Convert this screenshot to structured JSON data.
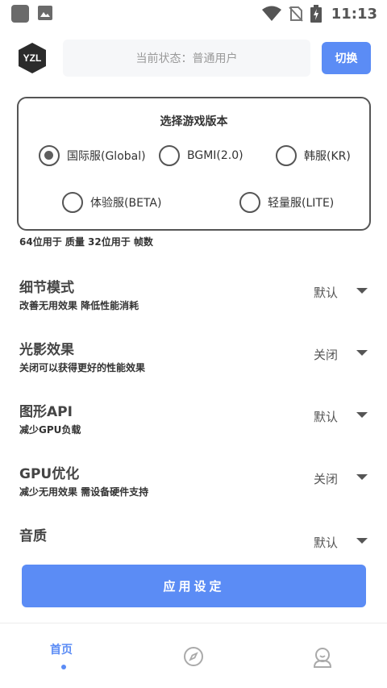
{
  "status_bar": {
    "time": "11:13"
  },
  "header": {
    "logo_text": "YZL",
    "status_text": "当前状态：普通用户",
    "switch_label": "切换"
  },
  "dialog": {
    "title": "选择游戏版本",
    "options": [
      {
        "label": "国际服(Global)",
        "checked": true
      },
      {
        "label": "BGMI(2.0)",
        "checked": false
      },
      {
        "label": "韩服(KR)",
        "checked": false
      },
      {
        "label": "体验服(BETA)",
        "checked": false
      },
      {
        "label": "轻量服(LITE)",
        "checked": false
      }
    ]
  },
  "settings": {
    "partial_top_text": "64位用于 质量 32位用于 帧数",
    "rows": [
      {
        "title": "细节模式",
        "subtitle": "改善无用效果 降低性能消耗",
        "value": "默认"
      },
      {
        "title": "光影效果",
        "subtitle": "关闭可以获得更好的性能效果",
        "value": "关闭"
      },
      {
        "title": "图形API",
        "subtitle": "减少GPU负载",
        "value": "默认"
      },
      {
        "title": "GPU优化",
        "subtitle": "减少无用效果 需设备硬件支持",
        "value": "关闭"
      },
      {
        "title": "音质",
        "subtitle": "",
        "value": "默认"
      }
    ]
  },
  "apply_label": "应用设定",
  "nav": {
    "home_label": "首页",
    "accent_color": "#5b8cf5"
  }
}
